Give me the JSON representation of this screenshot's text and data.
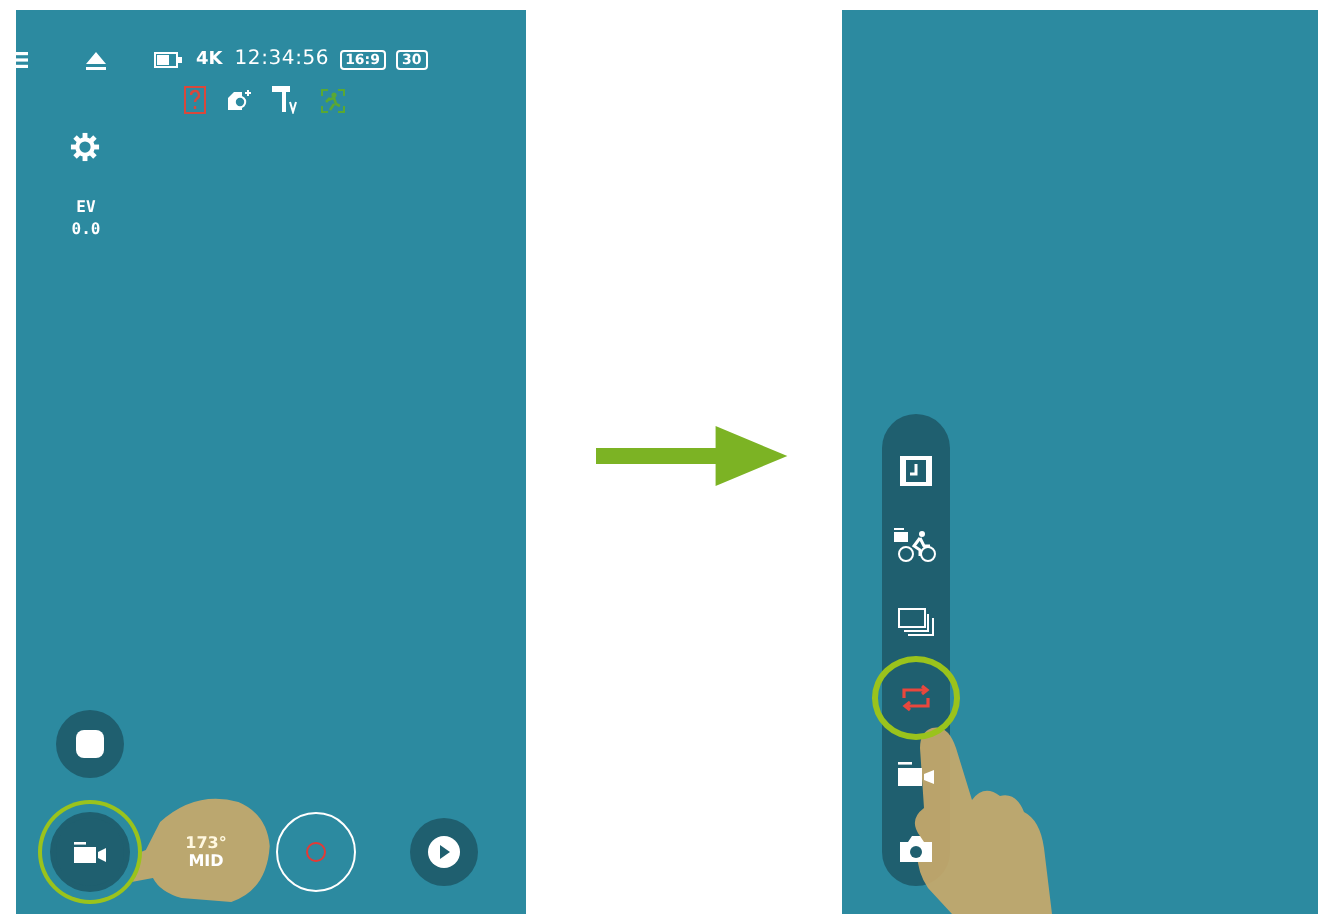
{
  "left_screen": {
    "status_bar": {
      "resolution": "4K",
      "time": "12:34:56",
      "aspect_ratio": "16:9",
      "frame_rate": "30"
    },
    "exposure": {
      "label": "EV",
      "value": "0.0"
    },
    "lens": {
      "angle": "173°",
      "mode": "MID"
    },
    "mode_button": {
      "highlighted": true
    }
  },
  "right_screen": {
    "mode_menu": {
      "items": [
        {
          "kind": "timelapse",
          "selected": false
        },
        {
          "kind": "sport",
          "selected": false
        },
        {
          "kind": "burst",
          "selected": false
        },
        {
          "kind": "loop",
          "selected": true
        },
        {
          "kind": "video",
          "selected": false
        },
        {
          "kind": "photo",
          "selected": false
        }
      ]
    }
  }
}
